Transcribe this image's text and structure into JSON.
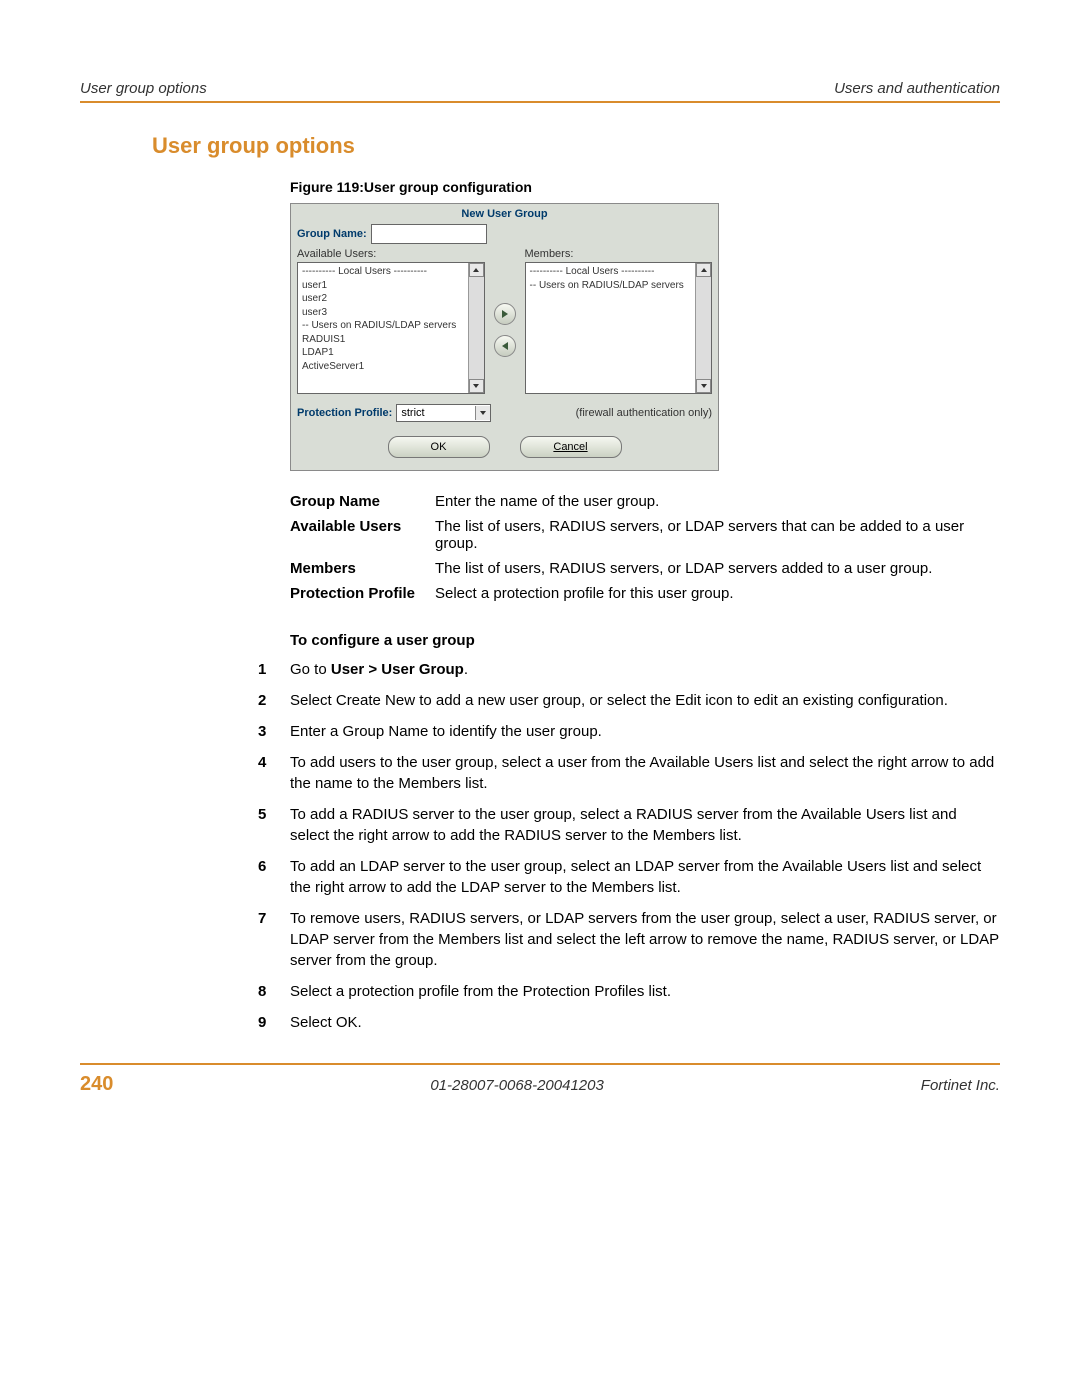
{
  "header": {
    "left": "User group options",
    "right": "Users and authentication"
  },
  "title": "User group options",
  "figure_caption": "Figure 119:User group configuration",
  "dialog": {
    "title": "New User Group",
    "group_name_label": "Group Name:",
    "available_label": "Available Users:",
    "members_label": "Members:",
    "available_items": [
      "---------- Local Users ----------",
      "user1",
      "user2",
      "user3",
      "-- Users on RADIUS/LDAP servers",
      "RADUIS1",
      "LDAP1",
      "ActiveServer1"
    ],
    "members_items": [
      "---------- Local Users ----------",
      "-- Users on RADIUS/LDAP servers"
    ],
    "protection_label": "Protection Profile:",
    "protection_value": "strict",
    "firewall_note": "(firewall authentication only)",
    "ok": "OK",
    "cancel": "Cancel"
  },
  "definitions": {
    "group_name_label": "Group Name",
    "group_name_text": "Enter the name of the user group.",
    "available_label": "Available Users",
    "available_text": "The list of users, RADIUS servers, or LDAP servers that can be added to a user group.",
    "members_label": "Members",
    "members_text": "The list of users, RADIUS servers, or LDAP servers added to a user group.",
    "protection_label": "Protection Profile",
    "protection_text": "Select a protection profile for this user group."
  },
  "subheading": "To configure a user group",
  "steps": {
    "s1_pre": "Go to ",
    "s1_bold": "User > User Group",
    "s1_post": ".",
    "s2": "Select Create New to add a new user group, or select the Edit icon to edit an existing configuration.",
    "s3": "Enter a Group Name to identify the user group.",
    "s4": "To add users to the user group, select a user from the Available Users list and select the right arrow to add the name to the Members list.",
    "s5": "To add a RADIUS server to the user group, select a RADIUS server from the Available Users list and select the right arrow to add the RADIUS server to the Members list.",
    "s6": "To add an LDAP server to the user group, select an LDAP server from the Available Users list and select the right arrow to add the LDAP server to the Members list.",
    "s7": "To remove users, RADIUS servers, or LDAP servers from the user group, select a user, RADIUS server, or LDAP server from the Members list and select the left arrow to remove the name, RADIUS server, or LDAP server from the group.",
    "s8": "Select a protection profile from the Protection Profiles list.",
    "s9": "Select OK."
  },
  "footer": {
    "page": "240",
    "center": "01-28007-0068-20041203",
    "right": "Fortinet Inc."
  }
}
